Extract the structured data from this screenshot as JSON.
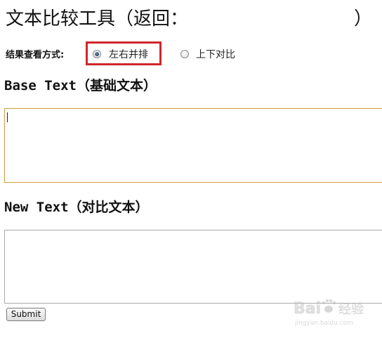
{
  "page": {
    "title": "文本比较工具（返回：",
    "title_close": "）"
  },
  "view_mode": {
    "label": "结果查看方式:",
    "options": [
      {
        "label": "左右并排",
        "checked": true
      },
      {
        "label": "上下对比",
        "checked": false
      }
    ],
    "highlight_color": "#d0262b"
  },
  "base_text": {
    "heading": "Base Text（基础文本）",
    "value": "",
    "focus_border_color": "#d0a24a"
  },
  "new_text": {
    "heading": "New Text（对比文本）",
    "value": ""
  },
  "actions": {
    "submit_label": "Submit"
  },
  "watermark": {
    "brand": "Bai",
    "brand_suffix": "经验",
    "url": "jingyan.baidu.com"
  }
}
